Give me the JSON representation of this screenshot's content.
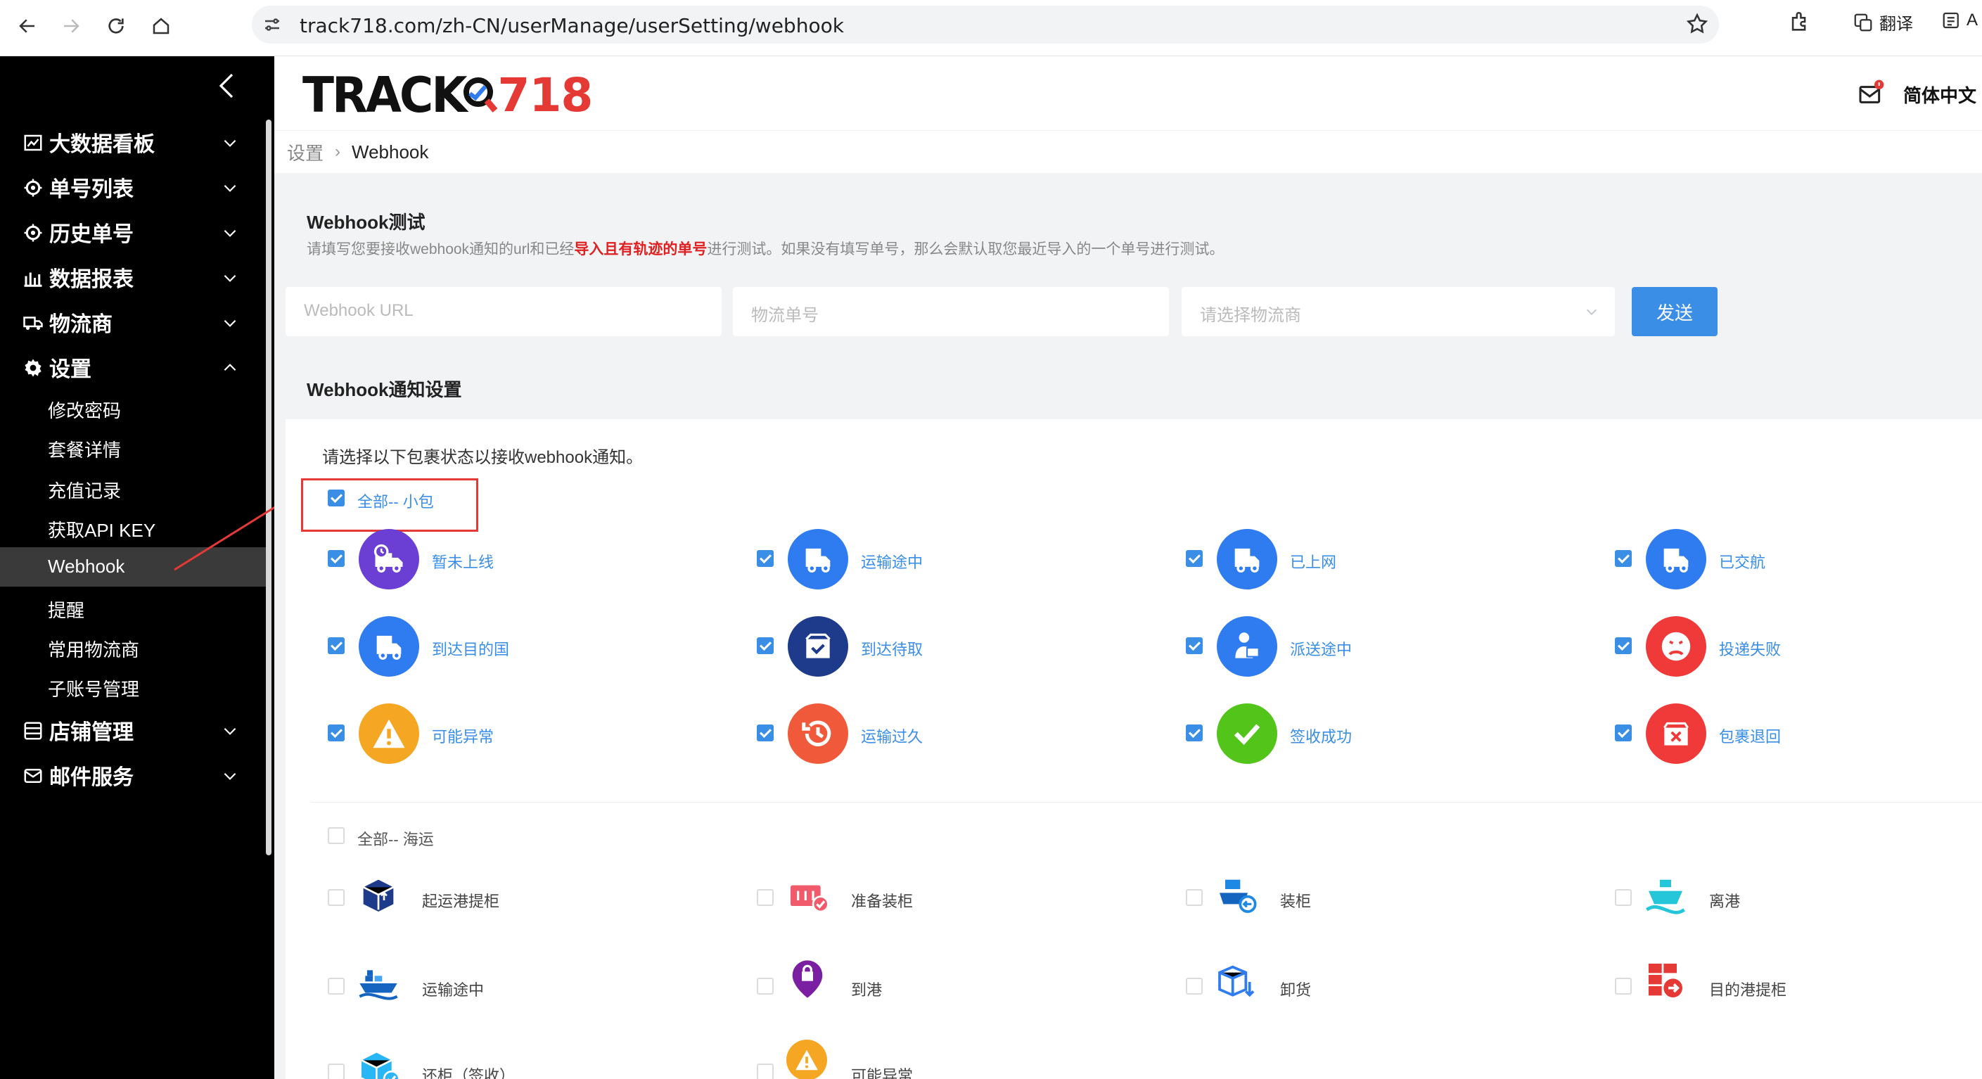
{
  "browser": {
    "url": "track718.com/zh-CN/userManage/userSetting/webhook",
    "translate_label": "翻译",
    "reader_label": "A"
  },
  "header": {
    "logo_left": "TRACK",
    "logo_right": "718",
    "language": "简体中文"
  },
  "sidebar": {
    "items": [
      {
        "label": "大数据看板"
      },
      {
        "label": "单号列表"
      },
      {
        "label": "历史单号"
      },
      {
        "label": "数据报表"
      },
      {
        "label": "物流商"
      },
      {
        "label": "设置"
      },
      {
        "label": "店铺管理"
      },
      {
        "label": "邮件服务"
      }
    ],
    "settings_sub": [
      {
        "label": "修改密码"
      },
      {
        "label": "套餐详情"
      },
      {
        "label": "充值记录"
      },
      {
        "label": "获取API KEY"
      },
      {
        "label": "Webhook"
      },
      {
        "label": "提醒"
      },
      {
        "label": "常用物流商"
      },
      {
        "label": "子账号管理"
      }
    ]
  },
  "breadcrumb": {
    "home": "设置",
    "current": "Webhook"
  },
  "test": {
    "title": "Webhook测试",
    "desc_before": "请填写您要接收webhook通知的url和已经",
    "desc_red": "导入且有轨迹的单号",
    "desc_after": "进行测试。如果没有填写单号，那么会默认取您最近导入的一个单号进行测试。",
    "url_placeholder": "Webhook URL",
    "number_placeholder": "物流单号",
    "carrier_placeholder": "请选择物流商",
    "send_label": "发送"
  },
  "notify": {
    "title": "Webhook通知设置",
    "hint": "请选择以下包裹状态以接收webhook通知。",
    "parcel_group": {
      "label": "全部-- 小包",
      "checked": true
    },
    "parcel_statuses": [
      {
        "label": "暂未上线",
        "color": "#6b3fd4",
        "icon": "truck-clock-icon"
      },
      {
        "label": "运输途中",
        "color": "#2f7bf0",
        "icon": "truck-icon"
      },
      {
        "label": "已上网",
        "color": "#2f7bf0",
        "icon": "truck-icon"
      },
      {
        "label": "已交航",
        "color": "#2f7bf0",
        "icon": "truck-icon"
      },
      {
        "label": "到达目的国",
        "color": "#2f7bf0",
        "icon": "truck-icon"
      },
      {
        "label": "到达待取",
        "color": "#1e3a8a",
        "icon": "box-check-icon"
      },
      {
        "label": "派送途中",
        "color": "#2f7bf0",
        "icon": "courier-icon"
      },
      {
        "label": "投递失败",
        "color": "#f03a3a",
        "icon": "sad-face-icon"
      },
      {
        "label": "可能异常",
        "color": "#f5a623",
        "icon": "warning-icon"
      },
      {
        "label": "运输过久",
        "color": "#f05a3a",
        "icon": "history-icon"
      },
      {
        "label": "签收成功",
        "color": "#52c41a",
        "icon": "check-icon"
      },
      {
        "label": "包裹退回",
        "color": "#f03a3a",
        "icon": "return-box-icon"
      }
    ],
    "sea_group": {
      "label": "全部-- 海运",
      "checked": false
    },
    "sea_statuses": [
      {
        "label": "起运港提柜",
        "icon": "container-pickup-icon"
      },
      {
        "label": "准备装柜",
        "icon": "container-prepare-icon"
      },
      {
        "label": "装柜",
        "icon": "ship-load-icon"
      },
      {
        "label": "离港",
        "icon": "ship-depart-icon"
      },
      {
        "label": "运输途中",
        "icon": "cargo-ship-icon"
      },
      {
        "label": "到港",
        "icon": "port-arrival-icon"
      },
      {
        "label": "卸货",
        "icon": "unload-icon"
      },
      {
        "label": "目的港提柜",
        "icon": "dest-pickup-icon"
      },
      {
        "label": "还柜（签收）",
        "icon": "container-return-icon"
      },
      {
        "label": "可能异常",
        "icon": "warning-icon"
      }
    ]
  }
}
